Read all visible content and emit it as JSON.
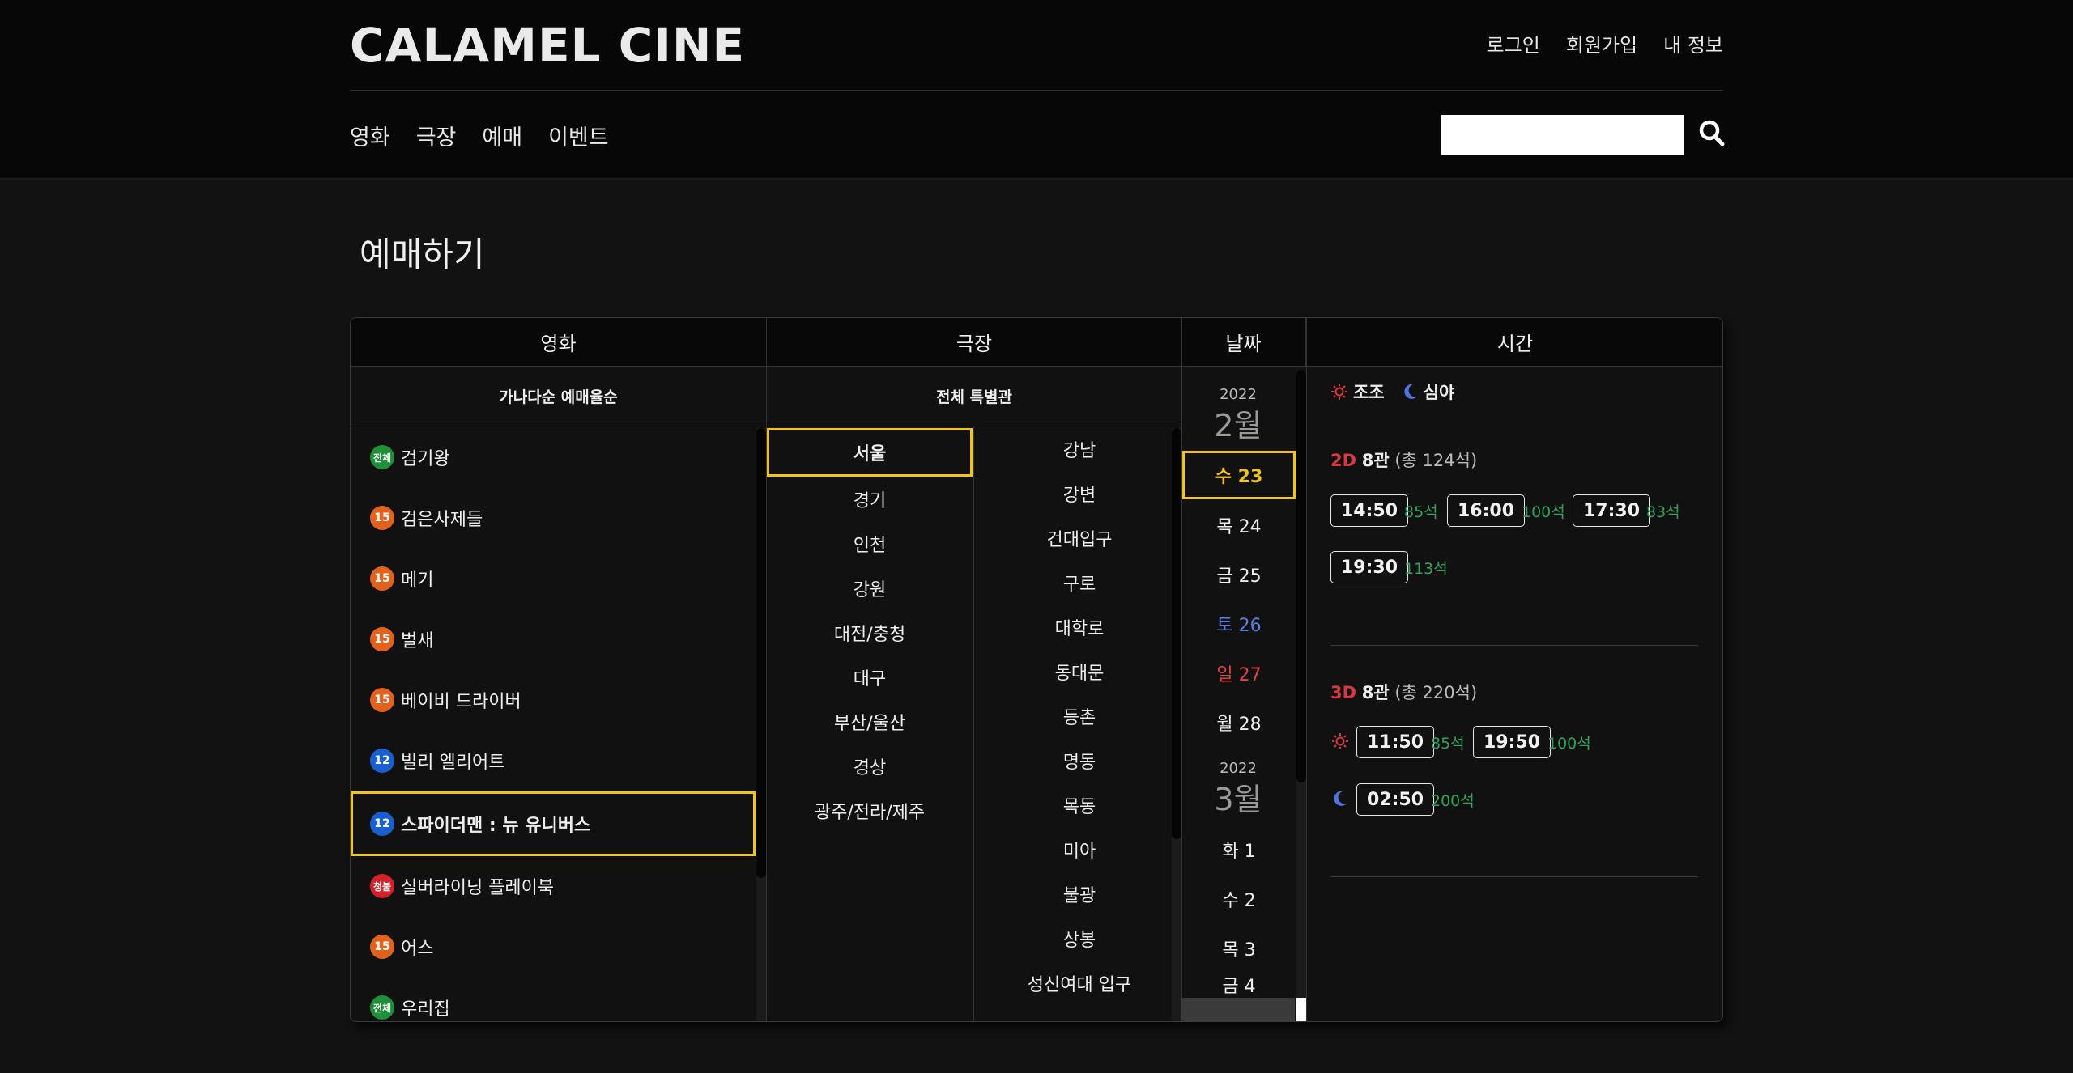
{
  "header": {
    "logo": "CALAMEL CINE",
    "user_menu": [
      "로그인",
      "회원가입",
      "내 정보"
    ],
    "nav": [
      "영화",
      "극장",
      "예매",
      "이벤트"
    ],
    "search_placeholder": ""
  },
  "page_title": "예매하기",
  "columns": {
    "movie": "영화",
    "theater": "극장",
    "date": "날짜",
    "time": "시간"
  },
  "movie_sort": "가나다순 예매율순",
  "theater_filter": "전체 특별관",
  "movies": [
    {
      "rating": "전체",
      "title": "검기왕"
    },
    {
      "rating": "15",
      "title": "검은사제들"
    },
    {
      "rating": "15",
      "title": "메기"
    },
    {
      "rating": "15",
      "title": "벌새"
    },
    {
      "rating": "15",
      "title": "베이비 드라이버"
    },
    {
      "rating": "12",
      "title": "빌리 엘리어트"
    },
    {
      "rating": "12",
      "title": "스파이더맨 : 뉴 유니버스"
    },
    {
      "rating": "청불",
      "title": "실버라이닝 플레이북"
    },
    {
      "rating": "15",
      "title": "어스"
    },
    {
      "rating": "전체",
      "title": "우리집"
    }
  ],
  "selected_movie": "스파이더맨 : 뉴 유니버스",
  "regions": [
    "서울",
    "경기",
    "인천",
    "강원",
    "대전/충청",
    "대구",
    "부산/울산",
    "경상",
    "광주/전라/제주"
  ],
  "selected_region": "서울",
  "theaters": [
    "강남",
    "강변",
    "건대입구",
    "구로",
    "대학로",
    "동대문",
    "등촌",
    "명동",
    "목동",
    "미아",
    "불광",
    "상봉",
    "성신여대 입구"
  ],
  "dates": {
    "feb": {
      "year": "2022",
      "month": "2월"
    },
    "mar": {
      "year": "2022",
      "month": "3월"
    },
    "feb_days": [
      {
        "label": "수 23",
        "kind": "selected"
      },
      {
        "label": "목 24",
        "kind": ""
      },
      {
        "label": "금 25",
        "kind": ""
      },
      {
        "label": "토 26",
        "kind": "sat"
      },
      {
        "label": "일 27",
        "kind": "sun"
      },
      {
        "label": "월 28",
        "kind": ""
      }
    ],
    "mar_days": [
      {
        "label": "화 1",
        "kind": ""
      },
      {
        "label": "수 2",
        "kind": ""
      },
      {
        "label": "목 3",
        "kind": ""
      },
      {
        "label": "금 4",
        "kind": ""
      }
    ]
  },
  "legend": {
    "morning": "조조",
    "late_night": "심야"
  },
  "halls": [
    {
      "format": "2D",
      "name": "8관",
      "total": "(총 124석)",
      "showtimes": [
        {
          "time": "14:50",
          "seats": "85석"
        },
        {
          "time": "16:00",
          "seats": "100석"
        },
        {
          "time": "17:30",
          "seats": "83석"
        },
        {
          "time": "19:30",
          "seats": "113석"
        }
      ]
    },
    {
      "format": "3D",
      "name": "8관",
      "total": "(총 220석)",
      "showtimes": [
        {
          "time": "11:50",
          "seats": "85석",
          "icon": "sun-icon"
        },
        {
          "time": "19:50",
          "seats": "100석"
        },
        {
          "time": "02:50",
          "seats": "200석",
          "icon": "moon-icon"
        }
      ]
    }
  ],
  "colors": {
    "accent": "#f0c419",
    "seat_green": "#2fa35c",
    "format_red": "#d8393e",
    "saturday": "#5b7fe6",
    "sunday": "#e04545"
  }
}
